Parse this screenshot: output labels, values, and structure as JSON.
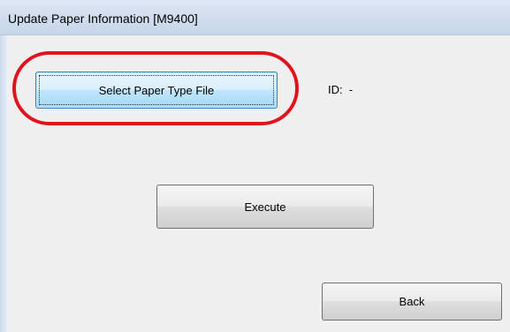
{
  "window": {
    "title": "Update Paper Information [M9400]"
  },
  "buttons": {
    "select_label": "Select Paper Type File",
    "execute_label": "Execute",
    "back_label": "Back"
  },
  "id": {
    "label": "ID:",
    "value": "-"
  },
  "annotation": {
    "color": "#e0141e"
  }
}
